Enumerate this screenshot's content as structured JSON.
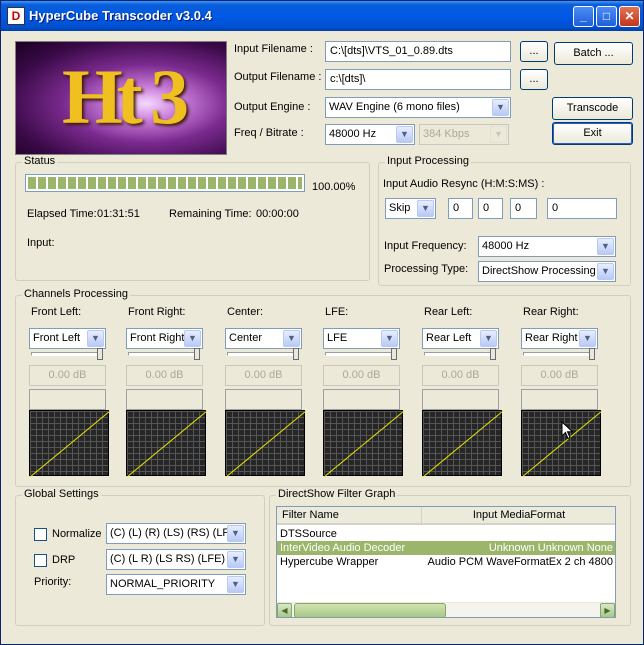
{
  "window": {
    "title": "HyperCube Transcoder v3.0.4",
    "icon_text": "D",
    "min_glyph": "_",
    "max_glyph": "□",
    "close_glyph": "✕"
  },
  "logo": {
    "text": "Ht 3"
  },
  "file": {
    "input_label": "Input Filename :",
    "input_value": "C:\\[dts]\\VTS_01_0.89.dts",
    "output_label": "Output Filename :",
    "output_value": "c:\\[dts]\\",
    "engine_label": "Output Engine :",
    "engine_value": "WAV Engine (6 mono files)",
    "freq_label": "Freq / Bitrate :",
    "freq_value": "48000 Hz",
    "bitrate_value": "384 Kbps",
    "browse_label": "..."
  },
  "buttons": {
    "batch": "Batch ...",
    "transcode": "Transcode",
    "exit": "Exit"
  },
  "status": {
    "title": "Status",
    "progress_text": "100.00%",
    "progress_value": 1.0,
    "elapsed_label": "Elapsed Time:",
    "elapsed_value": "01:31:51",
    "remaining_label": "Remaining Time:",
    "remaining_value": "00:00:00",
    "input_label": "Input:"
  },
  "input_processing": {
    "title": "Input Processing",
    "resync_label": "Input Audio Resync (H:M:S:MS) :",
    "resync_mode": "Skip",
    "h": "0",
    "m": "0",
    "s": "0",
    "ms": "0",
    "freq_label": "Input Frequency:",
    "freq_value": "48000 Hz",
    "type_label": "Processing Type:",
    "type_value": "DirectShow Processing"
  },
  "channels": {
    "title": "Channels Processing",
    "items": [
      {
        "label": "Front Left:",
        "select": "Front Left",
        "db": "0.00 dB"
      },
      {
        "label": "Front Right:",
        "select": "Front Right",
        "db": "0.00 dB"
      },
      {
        "label": "Center:",
        "select": "Center",
        "db": "0.00 dB"
      },
      {
        "label": "LFE:",
        "select": "LFE",
        "db": "0.00 dB"
      },
      {
        "label": "Rear Left:",
        "select": "Rear Left",
        "db": "0.00 dB"
      },
      {
        "label": "Rear Right:",
        "select": "Rear Right",
        "db": "0.00 dB"
      }
    ]
  },
  "global": {
    "title": "Global Settings",
    "normalize_label": "Normalize",
    "normalize_value": "(C) (L) (R) (LS) (RS) (LFE)",
    "drp_label": "DRP",
    "drp_value": "(C) (L R) (LS RS) (LFE)",
    "priority_label": "Priority:",
    "priority_value": "NORMAL_PRIORITY"
  },
  "filter_graph": {
    "title": "DirectShow Filter Graph",
    "columns": [
      "Filter Name",
      "Input MediaFormat"
    ],
    "rows": [
      {
        "name": "DTSSource",
        "format": ""
      },
      {
        "name": "InterVideo Audio Decoder",
        "format": "Unknown Unknown None"
      },
      {
        "name": "Hypercube Wrapper",
        "format": "Audio PCM WaveFormatEx 2 ch 4800"
      }
    ]
  },
  "colors": {
    "title_bar": "#0058e6",
    "progress": "#9bb66a",
    "selection": "#9bb66a",
    "graph_line": "#e8e800"
  },
  "icons": {
    "arrow": "▼",
    "left": "◀",
    "right": "▶"
  }
}
